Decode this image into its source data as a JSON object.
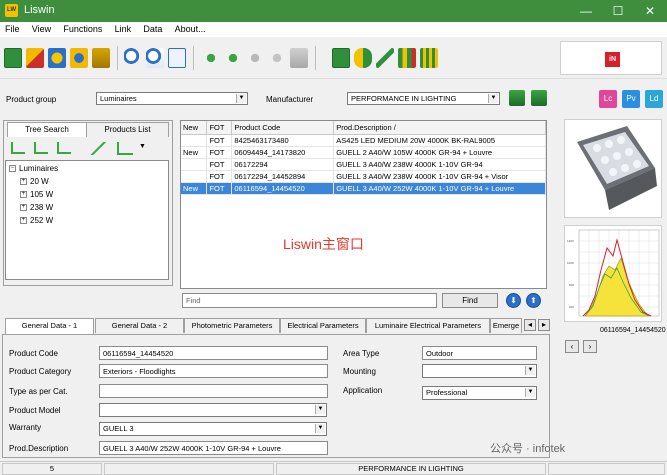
{
  "window": {
    "title": "Liswin",
    "app_icon_text": "LW"
  },
  "menu": [
    "File",
    "View",
    "Functions",
    "Link",
    "Data",
    "About..."
  ],
  "filters": {
    "product_group_label": "Product group",
    "product_group_value": "Luminaires",
    "manufacturer_label": "Manufacturer",
    "manufacturer_value": "PERFORMANCE IN LIGHTING"
  },
  "side_badges": [
    "Lc",
    "Pv",
    "Ld"
  ],
  "left_tabs": [
    "Tree Search",
    "Products List"
  ],
  "tree": {
    "root": "Luminaires",
    "children": [
      "20 W",
      "105 W",
      "238 W",
      "252 W"
    ]
  },
  "grid": {
    "columns": [
      "New",
      "FOT",
      "Product Code",
      "Prod.Description"
    ],
    "rows": [
      {
        "new": "",
        "fot": "FOT",
        "code": "8425463173480",
        "desc": "AS425 LED MEDIUM 20W 4000K BK-RAL9005",
        "selected": false
      },
      {
        "new": "New",
        "fot": "FOT",
        "code": "06094494_14173820",
        "desc": "GUELL 2 A40/W 105W 4000K GR-94 + Louvre",
        "selected": false
      },
      {
        "new": "",
        "fot": "FOT",
        "code": "06172294",
        "desc": "GUELL 3 A40/W 238W 4000K 1-10V GR-94",
        "selected": false
      },
      {
        "new": "",
        "fot": "FOT",
        "code": "06172294_14452894",
        "desc": "GUELL 3 A40/W 238W 4000K 1-10V GR-94 + Visor",
        "selected": false
      },
      {
        "new": "New",
        "fot": "FOT",
        "code": "06116594_14454520",
        "desc": "GUELL 3 A40/W 252W 4000K 1-10V GR-94 + Louvre",
        "selected": true
      }
    ]
  },
  "overlay_text": "Liswin主窗口",
  "find": {
    "placeholder": "Find",
    "button_label": "Find"
  },
  "image_caption": "06116594_14454520",
  "tabs": [
    "General Data - 1",
    "General Data - 2",
    "Photometric Parameters",
    "Electrical Parameters",
    "Luminaire Electrical Parameters",
    "Emerge"
  ],
  "form": {
    "product_code_label": "Product Code",
    "product_code_value": "06116594_14454520",
    "product_category_label": "Product Category",
    "product_category_value": "Exteriors - Floodlights",
    "type_as_per_cat_label": "Type as per Cat.",
    "type_as_per_cat_value": "",
    "product_model_label": "Product Model",
    "product_model_value": "",
    "warranty_label": "Warranty",
    "warranty_value": "GUELL 3",
    "prod_description_label": "Prod.Description",
    "prod_description_value": "GUELL 3 A40/W 252W 4000K 1-10V GR-94 + Louvre",
    "area_type_label": "Area Type",
    "area_type_value": "Outdoor",
    "mounting_label": "Mounting",
    "mounting_value": "",
    "application_label": "Application",
    "application_value": "Professional"
  },
  "status": {
    "count": "5",
    "manufacturer": "PERFORMANCE IN LIGHTING"
  },
  "watermark": "公众号 · infotek"
}
